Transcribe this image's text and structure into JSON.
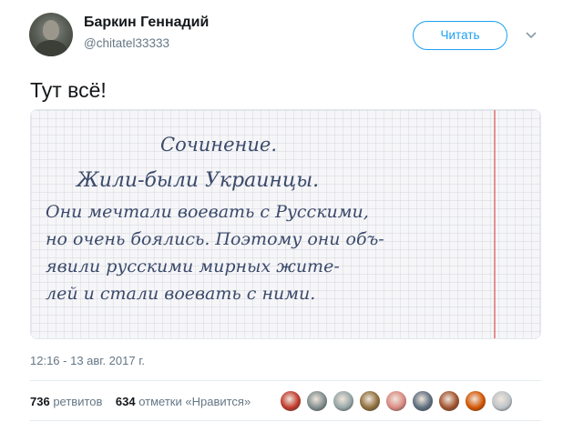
{
  "author": {
    "name": "Баркин Геннадий",
    "handle": "@chitatel33333"
  },
  "follow_button": "Читать",
  "tweet_text": "Тут всё!",
  "image": {
    "lines": [
      "Сочинение.",
      "Жили-были Украинцы.",
      "Они мечтали воевать с Русскими,",
      "но очень боялись. Поэтому они объ-",
      "явили русскими мирных жите-",
      "лей и стали воевать с ними."
    ]
  },
  "timestamp": "12:16 - 13 авг. 2017 г.",
  "stats": {
    "retweets_count": "736",
    "retweets_label": "ретвитов",
    "likes_count": "634",
    "likes_label": "отметки «Нравится»"
  },
  "liker_colors": [
    "#c0392b",
    "#7f8c8d",
    "#95a5a6",
    "#8e6e3b",
    "#d98880",
    "#5d6d7e",
    "#a0522d",
    "#d35400",
    "#bdc3c7"
  ]
}
